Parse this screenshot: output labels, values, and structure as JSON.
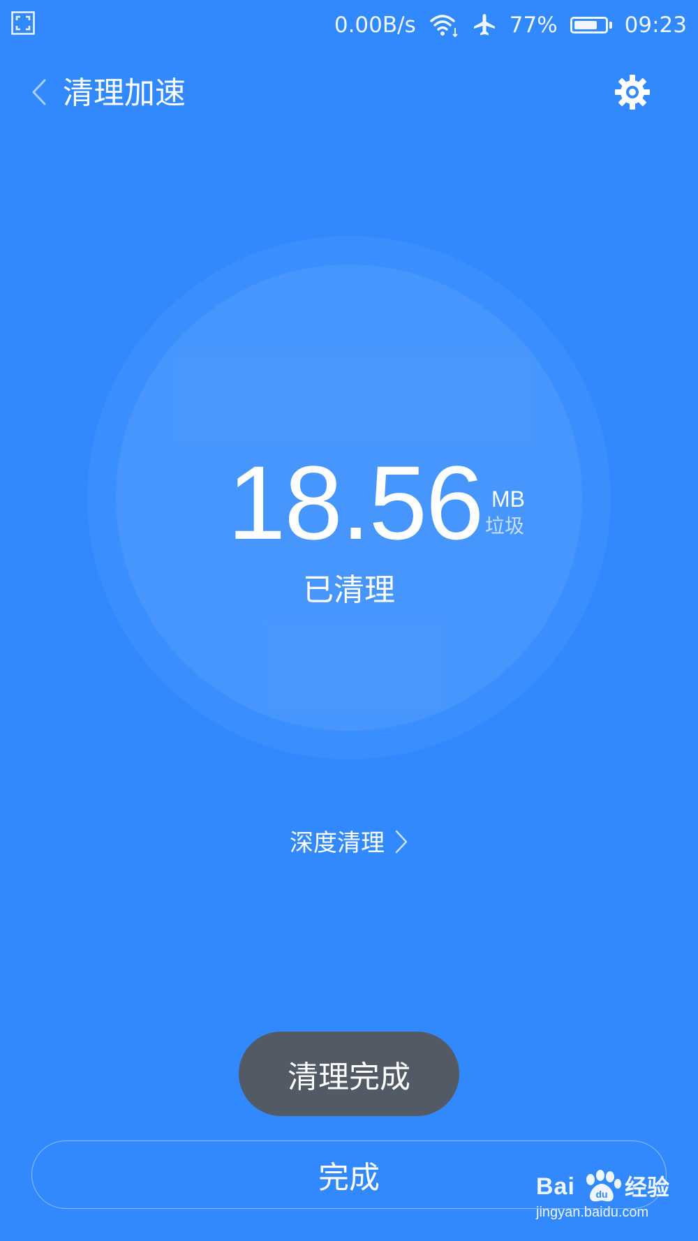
{
  "status_bar": {
    "left_icon": "screenshot-frame-icon",
    "network_speed": "0.00B/s",
    "wifi_icon": "wifi-icon",
    "airplane_icon": "airplane-icon",
    "battery_percent": "77%",
    "battery_level": 0.77,
    "time": "09:23"
  },
  "app_bar": {
    "back_icon": "chevron-left-icon",
    "title": "清理加速",
    "settings_icon": "gear-icon"
  },
  "result": {
    "amount": "18.56",
    "unit": "MB",
    "unit_sub": "垃圾",
    "status": "已清理"
  },
  "deep_clean": {
    "label": "深度清理",
    "icon": "chevron-right-icon"
  },
  "toast": {
    "text": "清理完成"
  },
  "done_button": {
    "label": "完成"
  },
  "watermark": {
    "brand": "Bai",
    "brand_suffix": "经验",
    "url": "jingyan.baidu.com"
  },
  "colors": {
    "background": "#3289fd",
    "toast_bg": "#525a65",
    "text": "#ffffff"
  }
}
